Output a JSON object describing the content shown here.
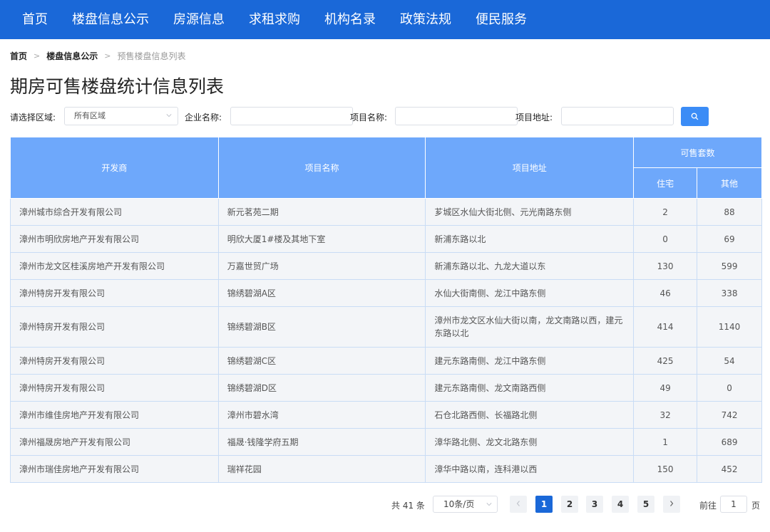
{
  "nav": {
    "items": [
      "首页",
      "楼盘信息公示",
      "房源信息",
      "求租求购",
      "机构名录",
      "政策法规",
      "便民服务"
    ]
  },
  "breadcrumb": {
    "home": "首页",
    "section": "楼盘信息公示",
    "current": "预售楼盘信息列表"
  },
  "page_title": "期房可售楼盘统计信息列表",
  "filters": {
    "region_label": "请选择区域:",
    "region_value": "所有区域",
    "company_label": "企业名称:",
    "project_label": "项目名称:",
    "address_label": "项目地址:"
  },
  "table": {
    "headers": {
      "developer": "开发商",
      "project": "项目名称",
      "address": "项目地址",
      "available": "可售套数",
      "residential": "住宅",
      "other": "其他"
    },
    "rows": [
      {
        "developer": "漳州城市综合开发有限公司",
        "project": "新元茗苑二期",
        "address": "芗城区水仙大街北侧、元光南路东侧",
        "residential": "2",
        "other": "88"
      },
      {
        "developer": "漳州市明欣房地产开发有限公司",
        "project": "明欣大厦1#楼及其地下室",
        "address": "新浦东路以北",
        "residential": "0",
        "other": "69"
      },
      {
        "developer": "漳州市龙文区桂溪房地产开发有限公司",
        "project": "万嘉世贸广场",
        "address": "新浦东路以北、九龙大道以东",
        "residential": "130",
        "other": "599"
      },
      {
        "developer": "漳州特房开发有限公司",
        "project": "锦绣碧湖A区",
        "address": "水仙大街南侧、龙江中路东侧",
        "residential": "46",
        "other": "338"
      },
      {
        "developer": "漳州特房开发有限公司",
        "project": "锦绣碧湖B区",
        "address": "漳州市龙文区水仙大街以南，龙文南路以西，建元东路以北",
        "residential": "414",
        "other": "1140"
      },
      {
        "developer": "漳州特房开发有限公司",
        "project": "锦绣碧湖C区",
        "address": "建元东路南侧、龙江中路东侧",
        "residential": "425",
        "other": "54"
      },
      {
        "developer": "漳州特房开发有限公司",
        "project": "锦绣碧湖D区",
        "address": "建元东路南侧、龙文南路西侧",
        "residential": "49",
        "other": "0"
      },
      {
        "developer": "漳州市维佳房地产开发有限公司",
        "project": "漳州市碧水湾",
        "address": "石仓北路西侧、长福路北侧",
        "residential": "32",
        "other": "742"
      },
      {
        "developer": "漳州福晟房地产开发有限公司",
        "project": "福晟·钱隆学府五期",
        "address": "漳华路北侧、龙文北路东侧",
        "residential": "1",
        "other": "689"
      },
      {
        "developer": "漳州市瑞佳房地产开发有限公司",
        "project": "瑞祥花园",
        "address": "漳华中路以南，连科港以西",
        "residential": "150",
        "other": "452"
      }
    ]
  },
  "pagination": {
    "total": "共 41 条",
    "page_size": "10条/页",
    "pages": [
      "1",
      "2",
      "3",
      "4",
      "5"
    ],
    "current": "1",
    "goto_prefix": "前往",
    "goto_value": "1",
    "goto_suffix": "页"
  },
  "colors": {
    "nav_bg": "#1a68d8",
    "table_header": "#6ea8fb",
    "search_button": "#3b8cf6",
    "active_page": "#1a68d8"
  }
}
